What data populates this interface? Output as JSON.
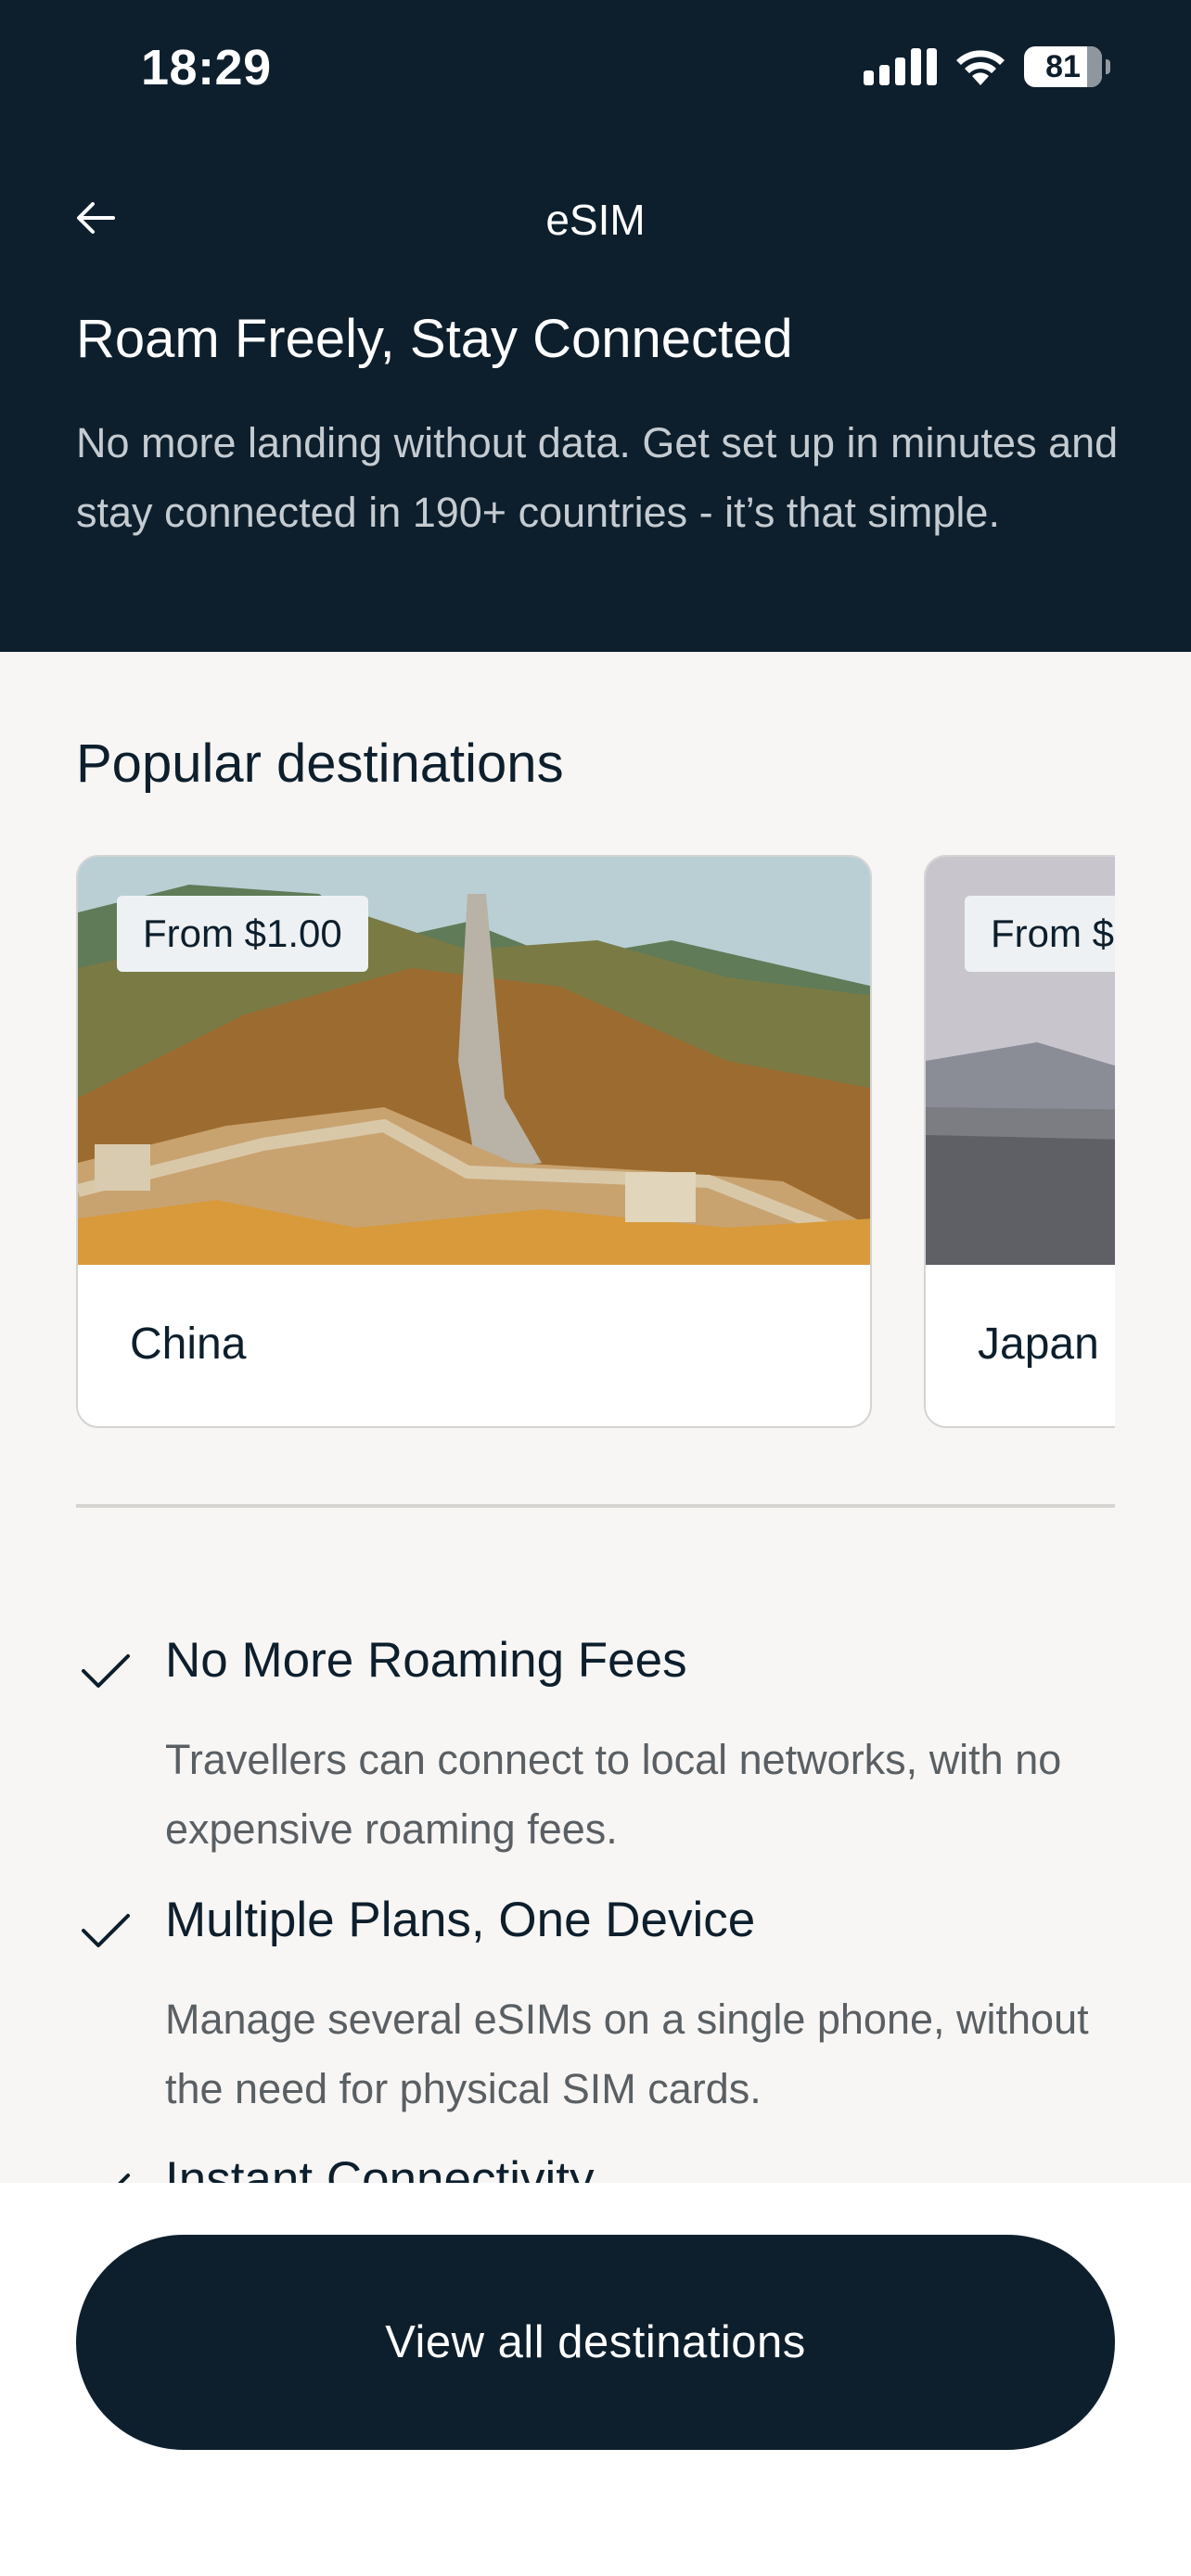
{
  "status_bar": {
    "time": "18:29",
    "battery": "81"
  },
  "nav": {
    "title": "eSIM"
  },
  "hero": {
    "title": "Roam Freely, Stay Connected",
    "description": "No more landing without data. Get set up in minutes and stay connected in 190+ countries - it’s that simple."
  },
  "popular": {
    "title": "Popular destinations",
    "cards": [
      {
        "price": "From $1.00",
        "name": "China"
      },
      {
        "price": "From $",
        "name": "Japan"
      }
    ]
  },
  "features": [
    {
      "title": "No More Roaming Fees",
      "description": "Travellers can connect to local networks, with no expensive roaming fees."
    },
    {
      "title": "Multiple Plans, One Device",
      "description": "Manage several eSIMs on a single phone, without the need for physical SIM cards."
    },
    {
      "title": "Instant Connectivity",
      "description": ""
    }
  ],
  "cta": {
    "label": "View all destinations"
  },
  "colors": {
    "navy": "#0d1f2d",
    "background": "#f7f6f4",
    "muted_text": "#5a5f63"
  },
  "icons": [
    "back-arrow-icon",
    "signal-icon",
    "wifi-icon",
    "battery-icon",
    "check-icon"
  ]
}
